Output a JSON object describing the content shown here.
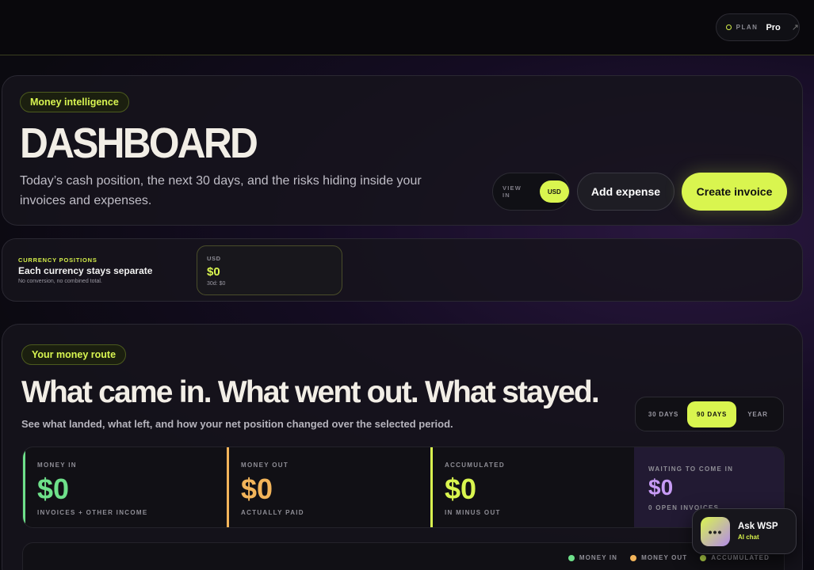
{
  "topbar": {
    "plan_label": "PLAN",
    "plan_value": "Pro",
    "plan_arrow_icon": "arrow-up-right-icon"
  },
  "hero": {
    "tag": "Money intelligence",
    "title": "DASHBOARD",
    "description": "Today’s cash position, the next 30 days, and the risks hiding inside your invoices and expenses.",
    "view_in_label": "VIEW IN",
    "view_in_value": "USD",
    "add_expense": "Add expense",
    "create_invoice": "Create invoice"
  },
  "currency": {
    "kicker": "CURRENCY POSITIONS",
    "title": "Each currency stays separate",
    "subtitle": "No conversion, no combined total.",
    "cards": [
      {
        "code": "USD",
        "amount": "$0",
        "thirty_day": "30d: $0"
      }
    ]
  },
  "route": {
    "tag": "Your money route",
    "title": "What came in. What went out. What stayed.",
    "description": "See what landed, what left, and how your net position changed over the selected period.",
    "periods": [
      "30 DAYS",
      "90 DAYS",
      "YEAR"
    ],
    "active_period": "90 DAYS",
    "stats": [
      {
        "label": "MONEY IN",
        "value": "$0",
        "sub": "INVOICES + OTHER INCOME",
        "color": "#6ee08a"
      },
      {
        "label": "MONEY OUT",
        "value": "$0",
        "sub": "ACTUALLY PAID",
        "color": "#f2b45a"
      },
      {
        "label": "ACCUMULATED",
        "value": "$0",
        "sub": "IN MINUS OUT",
        "color": "#d9f54f"
      },
      {
        "label": "WAITING TO COME IN",
        "value": "$0",
        "sub": "0 OPEN INVOICES",
        "color": "#c79bf5"
      }
    ],
    "legend": [
      {
        "label": "MONEY IN",
        "color": "#6ee08a"
      },
      {
        "label": "MONEY OUT",
        "color": "#f2b45a"
      },
      {
        "label": "ACCUMULATED",
        "color": "#b7d94a"
      }
    ]
  },
  "ask": {
    "title": "Ask WSP",
    "subtitle": "AI chat",
    "icon": "chat-dots-icon"
  }
}
